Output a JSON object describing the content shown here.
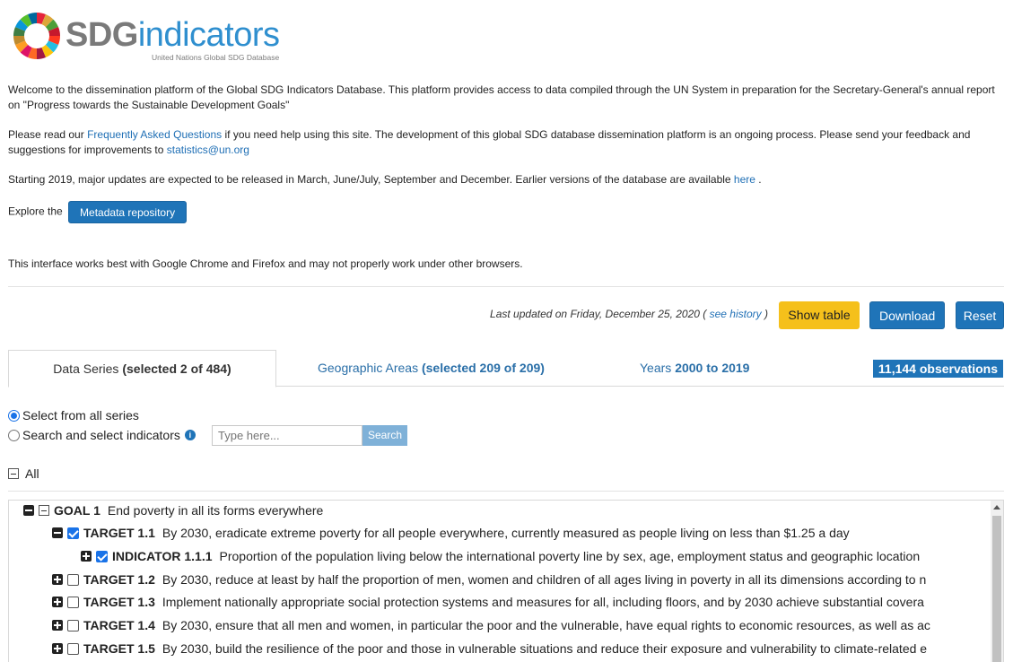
{
  "logo": {
    "sdg": "SDG",
    "indicators": "indicators",
    "subtitle": "United Nations Global SDG Database"
  },
  "intro": {
    "welcome": "Welcome to the dissemination platform of the Global SDG Indicators Database. This platform provides access to data compiled through the UN System in preparation for the Secretary-General's annual report on \"Progress towards the Sustainable Development Goals\"",
    "faq_pre": "Please read our ",
    "faq_link": "Frequently Asked Questions",
    "faq_post": " if you need help using this site. The development of this global SDG database dissemination platform is an ongoing process. Please send your feedback and suggestions for improvements to ",
    "email": "statistics@un.org",
    "updates_pre": "Starting 2019, major updates are expected to be released in March, June/July, September and December. Earlier versions of the database are available ",
    "here_link": "here",
    "updates_post": " .",
    "explore": "Explore the",
    "metadata_button": "Metadata repository",
    "browser_note": "This interface works best with Google Chrome and Firefox and may not properly work under other browsers."
  },
  "toolbar": {
    "updated_pre": "Last updated on Friday, December 25, 2020 ( ",
    "history_link": "see history",
    "updated_post": " )",
    "show_table": "Show table",
    "download": "Download",
    "reset": "Reset"
  },
  "tabs": {
    "series_label": "Data Series ",
    "series_count": "(selected 2 of 484)",
    "areas_label": "Geographic Areas ",
    "areas_count": "(selected 209 of 209)",
    "years_label": "Years ",
    "years_range": "2000 to 2019",
    "observations": "11,144 observations"
  },
  "selection": {
    "all_series": "Select from all series",
    "search_indicators": "Search and select indicators",
    "search_placeholder": "Type here...",
    "search_button": "Search",
    "all_label": "All"
  },
  "tree": {
    "goal": {
      "code": "GOAL 1",
      "text": "End poverty in all its forms everywhere"
    },
    "target_1_1": {
      "code": "TARGET 1.1",
      "text": "By 2030, eradicate extreme poverty for all people everywhere, currently measured as people living on less than $1.25 a day"
    },
    "indicator_1_1_1": {
      "code": "INDICATOR 1.1.1",
      "text": "Proportion of the population living below the international poverty line by sex, age, employment status and geographic location"
    },
    "target_1_2": {
      "code": "TARGET 1.2",
      "text": "By 2030, reduce at least by half the proportion of men, women and children of all ages living in poverty in all its dimensions according to n"
    },
    "target_1_3": {
      "code": "TARGET 1.3",
      "text": "Implement nationally appropriate social protection systems and measures for all, including floors, and by 2030 achieve substantial covera"
    },
    "target_1_4": {
      "code": "TARGET 1.4",
      "text": "By 2030, ensure that all men and women, in particular the poor and the vulnerable, have equal rights to economic resources, as well as ac"
    },
    "target_1_5": {
      "code": "TARGET 1.5",
      "text": "By 2030, build the resilience of the poor and those in vulnerable situations and reduce their exposure and vulnerability to climate-related e"
    }
  },
  "colors": {
    "primary": "#1f74b8",
    "accent": "#f5c01b",
    "link": "#1f6fb5"
  }
}
